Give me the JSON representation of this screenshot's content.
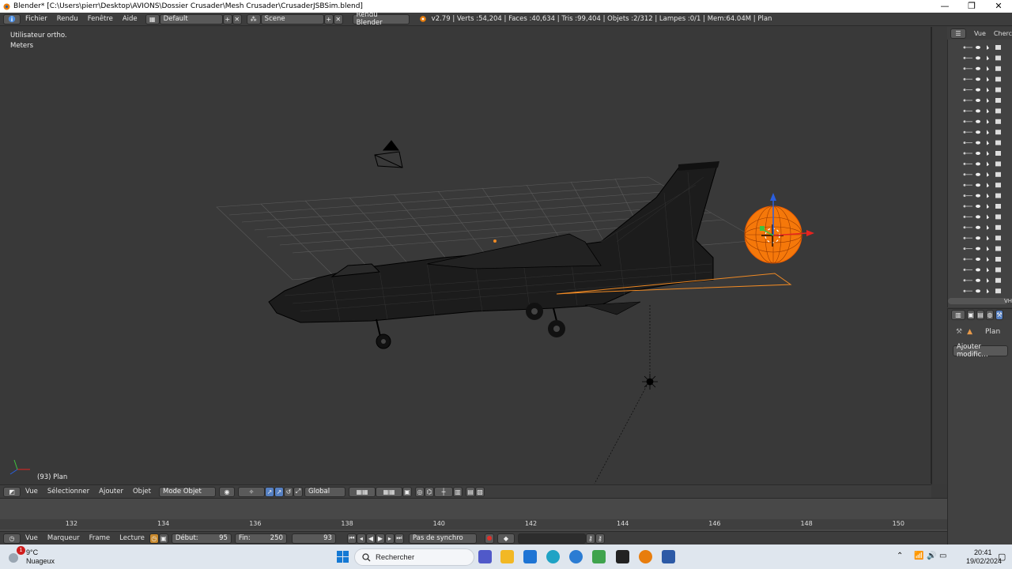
{
  "window": {
    "title": "Blender* [C:\\Users\\pierr\\Desktop\\AVIONS\\Dossier Crusader\\Mesh Crusader\\CrusaderJSBSim.blend]",
    "minimize": "—",
    "maximize": "❐",
    "close": "✕"
  },
  "info_header": {
    "menus": [
      "Fichier",
      "Rendu",
      "Fenêtre",
      "Aide"
    ],
    "layout": "Default",
    "scene": "Scene",
    "engine": "Rendu Blender",
    "stats": "v2.79 | Verts :54,204 | Faces :40,634 | Tris :99,404 | Objets :2/312 | Lampes :0/1 | Mem:64.04M | Plan"
  },
  "viewport": {
    "view_name": "Utilisateur ortho.",
    "units": "Meters",
    "object_info": "(93) Plan"
  },
  "view3d_header": {
    "menus": [
      "Vue",
      "Sélectionner",
      "Ajouter",
      "Objet"
    ],
    "mode": "Mode Objet",
    "orientation": "Global"
  },
  "timeline": {
    "ticks": [
      "132",
      "134",
      "136",
      "138",
      "140",
      "142",
      "144",
      "146",
      "148",
      "150"
    ],
    "tick_positions": [
      0.0755,
      0.1725,
      0.2695,
      0.3665,
      0.4635,
      0.5605,
      0.6575,
      0.7545,
      0.8515,
      0.9485
    ]
  },
  "timeline_header": {
    "menus": [
      "Vue",
      "Marqueur",
      "Frame",
      "Lecture"
    ],
    "start_label": "Début:",
    "start_value": "95",
    "end_label": "Fin:",
    "end_value": "250",
    "current_frame": "93",
    "sync": "Pas de synchro"
  },
  "outliner": {
    "header_view": "Vue",
    "header_search": "Cherc",
    "scroll_label": "VH"
  },
  "properties": {
    "object_name": "Plan",
    "add_modifier": "Ajouter modific…"
  },
  "taskbar": {
    "weather_temp": "9°C",
    "weather_desc": "Nuageux",
    "notification_count": "1",
    "search_placeholder": "Rechercher",
    "time": "20:41",
    "date": "19/02/2024"
  },
  "colors": {
    "selection_orange": "#f08a24",
    "viewport_bg": "#393939",
    "header_bg": "#3d3d3d",
    "axis_x": "#e8231f",
    "axis_y": "#3ec43e",
    "axis_z": "#2a5fe0"
  }
}
